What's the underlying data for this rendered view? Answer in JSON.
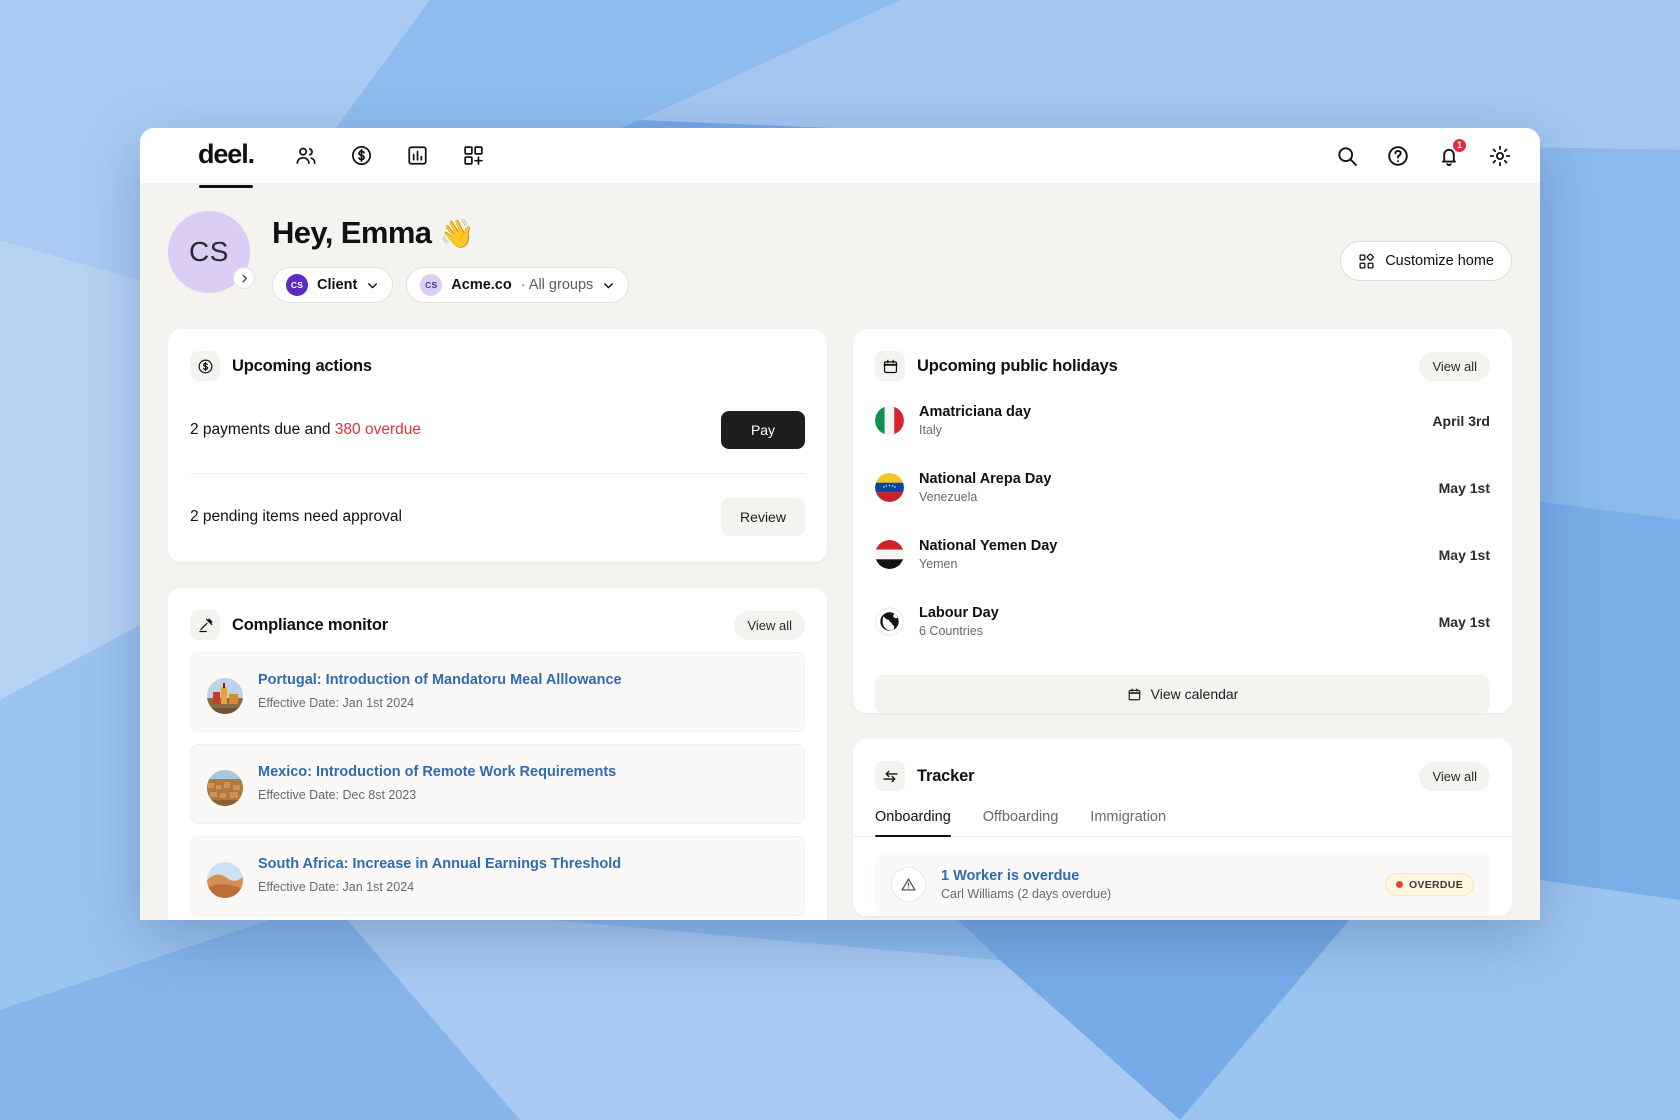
{
  "brand": {
    "logo": "deel.",
    "accent": "#5b2bc4",
    "danger": "#e0303d",
    "link": "#2d6cb0"
  },
  "topnav": {
    "icons": [
      "people-icon",
      "dollar-coin-icon",
      "bar-chart-icon",
      "apps-add-icon"
    ],
    "right_icons": [
      "search-icon",
      "help-circle-icon",
      "bell-icon",
      "gear-icon"
    ],
    "notification_count": "1"
  },
  "greeting": {
    "avatar_initials": "CS",
    "title": "Hey, Emma",
    "wave_emoji": "👋",
    "pills": [
      {
        "initials": "CS",
        "label": "Client",
        "suffix": ""
      },
      {
        "initials": "CS",
        "label": "Acme.co",
        "suffix": " · All groups"
      }
    ],
    "customize_label": "Customize home"
  },
  "upcoming_actions": {
    "icon": "dollar-coin-icon",
    "title": "Upcoming actions",
    "rows": [
      {
        "text_before": "2 payments due and ",
        "highlight": "380 overdue",
        "button": "Pay",
        "style": "dark"
      },
      {
        "text_before": "2 pending items need approval",
        "highlight": "",
        "button": "Review",
        "style": "light"
      }
    ]
  },
  "compliance_monitor": {
    "icon": "gavel-icon",
    "title": "Compliance monitor",
    "view_all": "View all",
    "items": [
      {
        "title": "Portugal: Introduction of Mandatoru Meal Alllowance",
        "date": "Effective Date: Jan 1st 2024",
        "thumb": "portugal-castle-thumb"
      },
      {
        "title": "Mexico: Introduction of Remote Work Requirements",
        "date": "Effective Date: Dec 8st 2023",
        "thumb": "mexico-city-thumb"
      },
      {
        "title": "South Africa: Increase in Annual Earnings Threshold",
        "date": "Effective Date: Jan 1st 2024",
        "thumb": "south-africa-dune-thumb"
      }
    ]
  },
  "public_holidays": {
    "icon": "calendar-icon",
    "title": "Upcoming public holidays",
    "view_all": "View all",
    "items": [
      {
        "name": "Amatriciana day",
        "sub": "Italy",
        "date": "April 3rd",
        "flag": "flag-italy"
      },
      {
        "name": "National Arepa Day",
        "sub": "Venezuela",
        "date": "May 1st",
        "flag": "flag-venezuela"
      },
      {
        "name": "National Yemen Day",
        "sub": "Yemen",
        "date": "May 1st",
        "flag": "flag-yemen"
      },
      {
        "name": "Labour Day",
        "sub": "6 Countries",
        "date": "May 1st",
        "flag": "globe-icon"
      }
    ],
    "calendar_button": "View calendar"
  },
  "tracker": {
    "icon": "transfer-arrows-icon",
    "title": "Tracker",
    "view_all": "View all",
    "tabs": [
      {
        "label": "Onboarding",
        "active": true
      },
      {
        "label": "Offboarding",
        "active": false
      },
      {
        "label": "Immigration",
        "active": false
      }
    ],
    "rows": [
      {
        "title": "1 Worker is overdue",
        "sub": "Carl Williams (2 days overdue)",
        "badge": "OVERDUE",
        "badge_color": "#e0453f",
        "icon": "warning-triangle-icon"
      }
    ]
  }
}
